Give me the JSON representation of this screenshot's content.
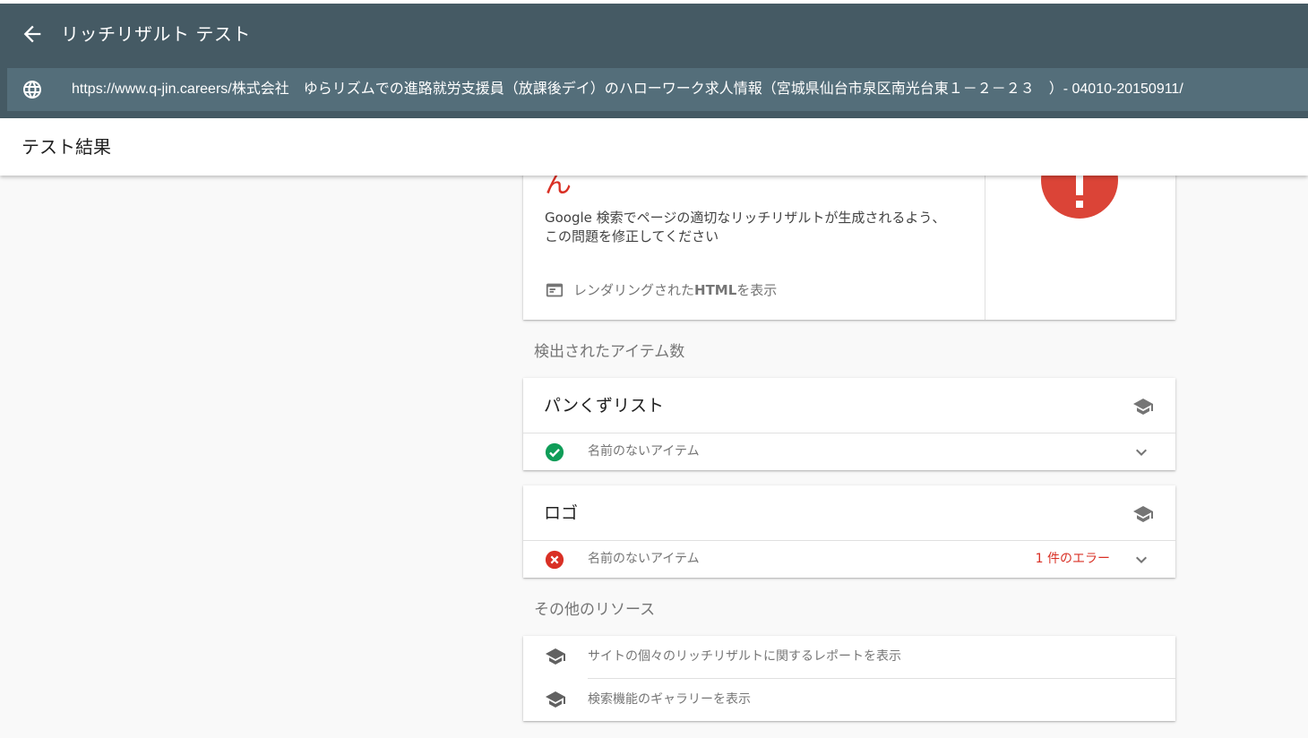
{
  "app": {
    "title": "リッチリザルト テスト",
    "tested_url": "https://www.q-jin.careers/株式会社　ゆらリズムでの進路就労支援員（放課後デイ）のハローワーク求人情報（宮城県仙台市泉区南光台東１－２－２３　）- 04010-20150911/"
  },
  "subheader": {
    "label": "テスト結果"
  },
  "summary": {
    "heading_fragment": "ん",
    "description": "Google 検索でページの適切なリッチリザルトが生成されるよう、この問題を修正してください",
    "render_link_prefix": "レンダリングされた ",
    "render_link_bold": "HTML",
    "render_link_suffix": " を表示",
    "status_mark": "!",
    "status_color": "#db4437"
  },
  "detected": {
    "section_label": "検出されたアイテム数",
    "items": [
      {
        "name": "パンくずリスト",
        "row_label": "名前のないアイテム",
        "status": "valid",
        "error_text": ""
      },
      {
        "name": "ロゴ",
        "row_label": "名前のないアイテム",
        "status": "error",
        "error_text": "1 件のエラー"
      }
    ]
  },
  "resources": {
    "section_label": "その他のリソース",
    "links": [
      {
        "label": "サイトの個々のリッチリザルトに関するレポートを表示",
        "icon": "school-cap-icon"
      },
      {
        "label": "検索機能のギャラリーを表示",
        "icon": "school-cap-icon"
      }
    ]
  },
  "colors": {
    "appbar": "#455a64",
    "urlbar": "#546e7a",
    "valid": "#0f9d58",
    "error": "#d93025"
  }
}
